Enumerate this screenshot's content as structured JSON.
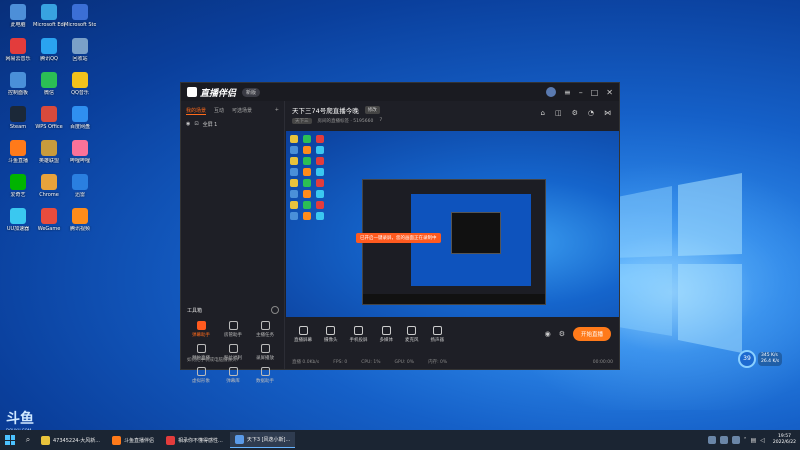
{
  "desktop": {
    "icons": [
      {
        "label": "此电脑",
        "color": "#4d8fd8"
      },
      {
        "label": "Microsoft Edge",
        "color": "#38a3e0"
      },
      {
        "label": "Microsoft Store",
        "color": "#3b6fd6"
      },
      {
        "label": "网易云音乐",
        "color": "#e33c3c"
      },
      {
        "label": "腾讯QQ",
        "color": "#2aa3f0"
      },
      {
        "label": "回收站",
        "color": "#7aa0c8"
      },
      {
        "label": "控制面板",
        "color": "#4a90d9"
      },
      {
        "label": "微信",
        "color": "#2bbf55"
      },
      {
        "label": "QQ音乐",
        "color": "#f2c21b"
      },
      {
        "label": "Steam",
        "color": "#1b2838"
      },
      {
        "label": "WPS Office",
        "color": "#d84a3c"
      },
      {
        "label": "百度网盘",
        "color": "#2f8ff0"
      },
      {
        "label": "斗鱼直播",
        "color": "#ff7a1a"
      },
      {
        "label": "英雄联盟",
        "color": "#c89b3c"
      },
      {
        "label": "哔哩哔哩",
        "color": "#fb7299"
      },
      {
        "label": "爱奇艺",
        "color": "#00b400"
      },
      {
        "label": "Chrome",
        "color": "#e8a33c"
      },
      {
        "label": "迅雷",
        "color": "#2a7fe0"
      },
      {
        "label": "UU加速器",
        "color": "#3ac8f0"
      },
      {
        "label": "WeGame",
        "color": "#e84c3d"
      },
      {
        "label": "腾讯视频",
        "color": "#ff8c1a"
      }
    ]
  },
  "app": {
    "name": "直播伴侣",
    "version": "新版",
    "tabs": [
      "我的场景",
      "互动",
      "可选场景"
    ],
    "scene": "全屏 1",
    "tools_title": "工具箱",
    "tools": [
      "弹幕助手",
      "房管助手",
      "主播任务",
      "预约直播",
      "粉丝福利",
      "录屏播放",
      "虚拟形象",
      "弹幕库",
      "数据助手"
    ],
    "tip": "如何把手机或电脑摄像头?",
    "room": {
      "title": "天下三74号爬直播今晚",
      "tag": "修改",
      "sub_tag": "天下三",
      "sub_text": "房间的直播标签 · 5195660",
      "fans": "7"
    },
    "callout": "已开启一键录屏，您的画面正在录制中",
    "controls": [
      "直播屏幕",
      "摄像头",
      "手机投屏",
      "多媒体",
      "麦克风",
      "扬声器"
    ],
    "live_button": "开始直播",
    "status": [
      "直播 0.0Kb/s",
      "FPS: 0",
      "CPU: 1%",
      "GPU: 0%",
      "内存: 0%",
      "00:00:00"
    ]
  },
  "perf": {
    "percent": "39",
    "up": "345 K/s",
    "down": "26.4 K/s"
  },
  "watermark": {
    "line1": "斗鱼",
    "line2": "DOUYU.COM"
  },
  "taskbar": {
    "tasks": [
      {
        "label": "47345224-大风新...",
        "color": "#e8c33c"
      },
      {
        "label": "斗鱼直播伴侣",
        "color": "#ff7a1a"
      },
      {
        "label": "相承你不懂得感性...",
        "color": "#e33c3c"
      },
      {
        "label": "天下3 [风逸小斯]...",
        "color": "#5a9ae8"
      }
    ],
    "time": "19:57",
    "date": "2022/6/22"
  }
}
